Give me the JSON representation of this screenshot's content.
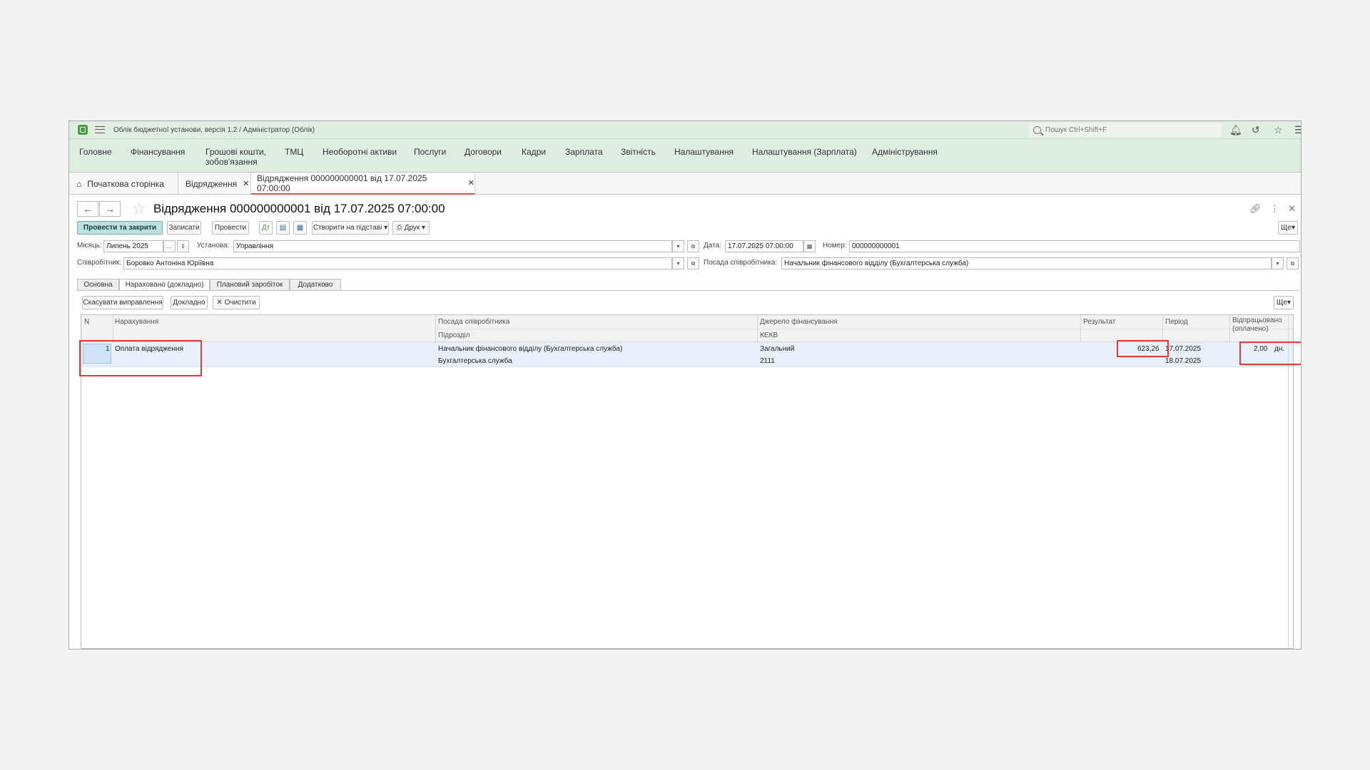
{
  "app": {
    "title": "Облік бюджетної установи, версія 1.2 / Адміністратор  (Облік)"
  },
  "search": {
    "placeholder": "Пошук Ctrl+Shift+F"
  },
  "menu": [
    "Головне",
    "Фінансування",
    "Грошові кошти,\nзобов'язання",
    "ТМЦ",
    "Необоротні активи",
    "Послуги",
    "Договори",
    "Кадри",
    "Зарплата",
    "Звітність",
    "Налаштування",
    "Налаштування (Зарплата)",
    "Адміністрування"
  ],
  "open_tabs": [
    "Початкова сторінка",
    "Відрядження",
    "Відрядження 000000000001 від 17.07.2025 07:00:00"
  ],
  "document": {
    "title": "Відрядження 000000000001 від 17.07.2025 07:00:00"
  },
  "toolbar": {
    "post_close": "Провести та закрити",
    "save": "Записати",
    "post": "Провести",
    "create_based": "Створити на підставі",
    "print": "Друк",
    "more": "Ще"
  },
  "form": {
    "month_label": "Місяць:",
    "month_value": "Липень 2025",
    "org_label": "Установа:",
    "org_value": "Управління",
    "date_label": "Дата:",
    "date_value": "17.07.2025 07:00:00",
    "number_label": "Номер:",
    "number_value": "000000000001",
    "employee_label": "Співробітник:",
    "employee_value": "Боровко Антоніна Юріївна",
    "position_label": "Посада співробітника:",
    "position_value": "Начальник фінансового відділу (Бухгалтерська служба)"
  },
  "form_tabs": [
    "Основна",
    "Нараховано (докладно)",
    "Плановий заробіток",
    "Додатково"
  ],
  "grid_toolbar": {
    "cancel_fix": "Скасувати виправлення",
    "detailed": "Докладно",
    "clear": "Очистити",
    "more": "Ще"
  },
  "grid": {
    "headers": {
      "n": "N",
      "accrual": "Нарахування",
      "position": "Посада співробітника",
      "subdivision": "Підрозділ",
      "source": "Джерело фінансування",
      "kekv": "КЕКВ",
      "result": "Результат",
      "period": "Період",
      "worked": "Відпрацьовано\n(оплачено)"
    },
    "rows": [
      {
        "n": "1",
        "accrual": "Оплата відрядження",
        "position": "Начальник фінансового відділу (Бухгалтерська служба)",
        "subdivision": "Бухгалтерська служба",
        "source": "Загальний",
        "kekv": "2111",
        "result": "623,26",
        "period_from": "17.07.2025",
        "period_to": "18.07.2025",
        "worked": "2,00",
        "worked_unit": "дн."
      }
    ]
  },
  "colors": {
    "header_green": "#dfeee0",
    "highlight": "#e53935",
    "row_selected": "#e8f1fa"
  }
}
